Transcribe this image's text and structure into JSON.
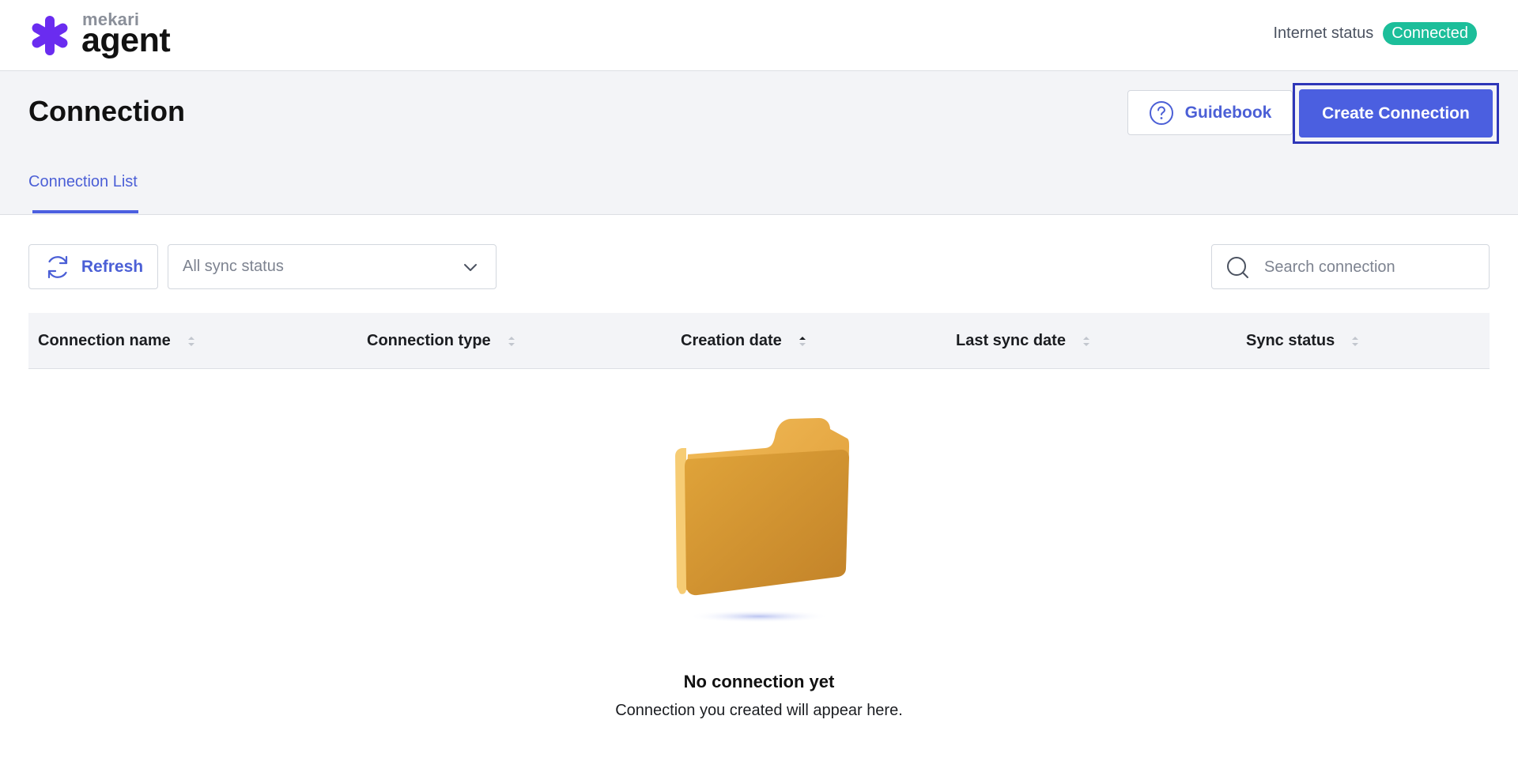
{
  "app": {
    "brand_small": "mekari",
    "brand_big": "agent",
    "internet_status_label": "Internet status",
    "internet_status_value": "Connected"
  },
  "header": {
    "title": "Connection",
    "guidebook_label": "Guidebook",
    "create_label": "Create Connection",
    "tabs": [
      {
        "label": "Connection List",
        "active": true
      }
    ]
  },
  "toolbar": {
    "refresh_label": "Refresh",
    "sync_filter_value": "All sync status",
    "search_placeholder": "Search connection"
  },
  "table": {
    "columns": [
      {
        "label": "Connection name",
        "sort": "none"
      },
      {
        "label": "Connection type",
        "sort": "none"
      },
      {
        "label": "Creation date",
        "sort": "asc"
      },
      {
        "label": "Last sync date",
        "sort": "none"
      },
      {
        "label": "Sync status",
        "sort": "none"
      }
    ],
    "rows": []
  },
  "empty_state": {
    "icon": "folder-icon",
    "title": "No connection yet",
    "subtitle": "Connection you created will appear here."
  },
  "colors": {
    "accent": "#4b5fe0",
    "success": "#1cbe9a",
    "brand_star": "#6a2cf0",
    "focus_outline": "#2e36b8"
  }
}
